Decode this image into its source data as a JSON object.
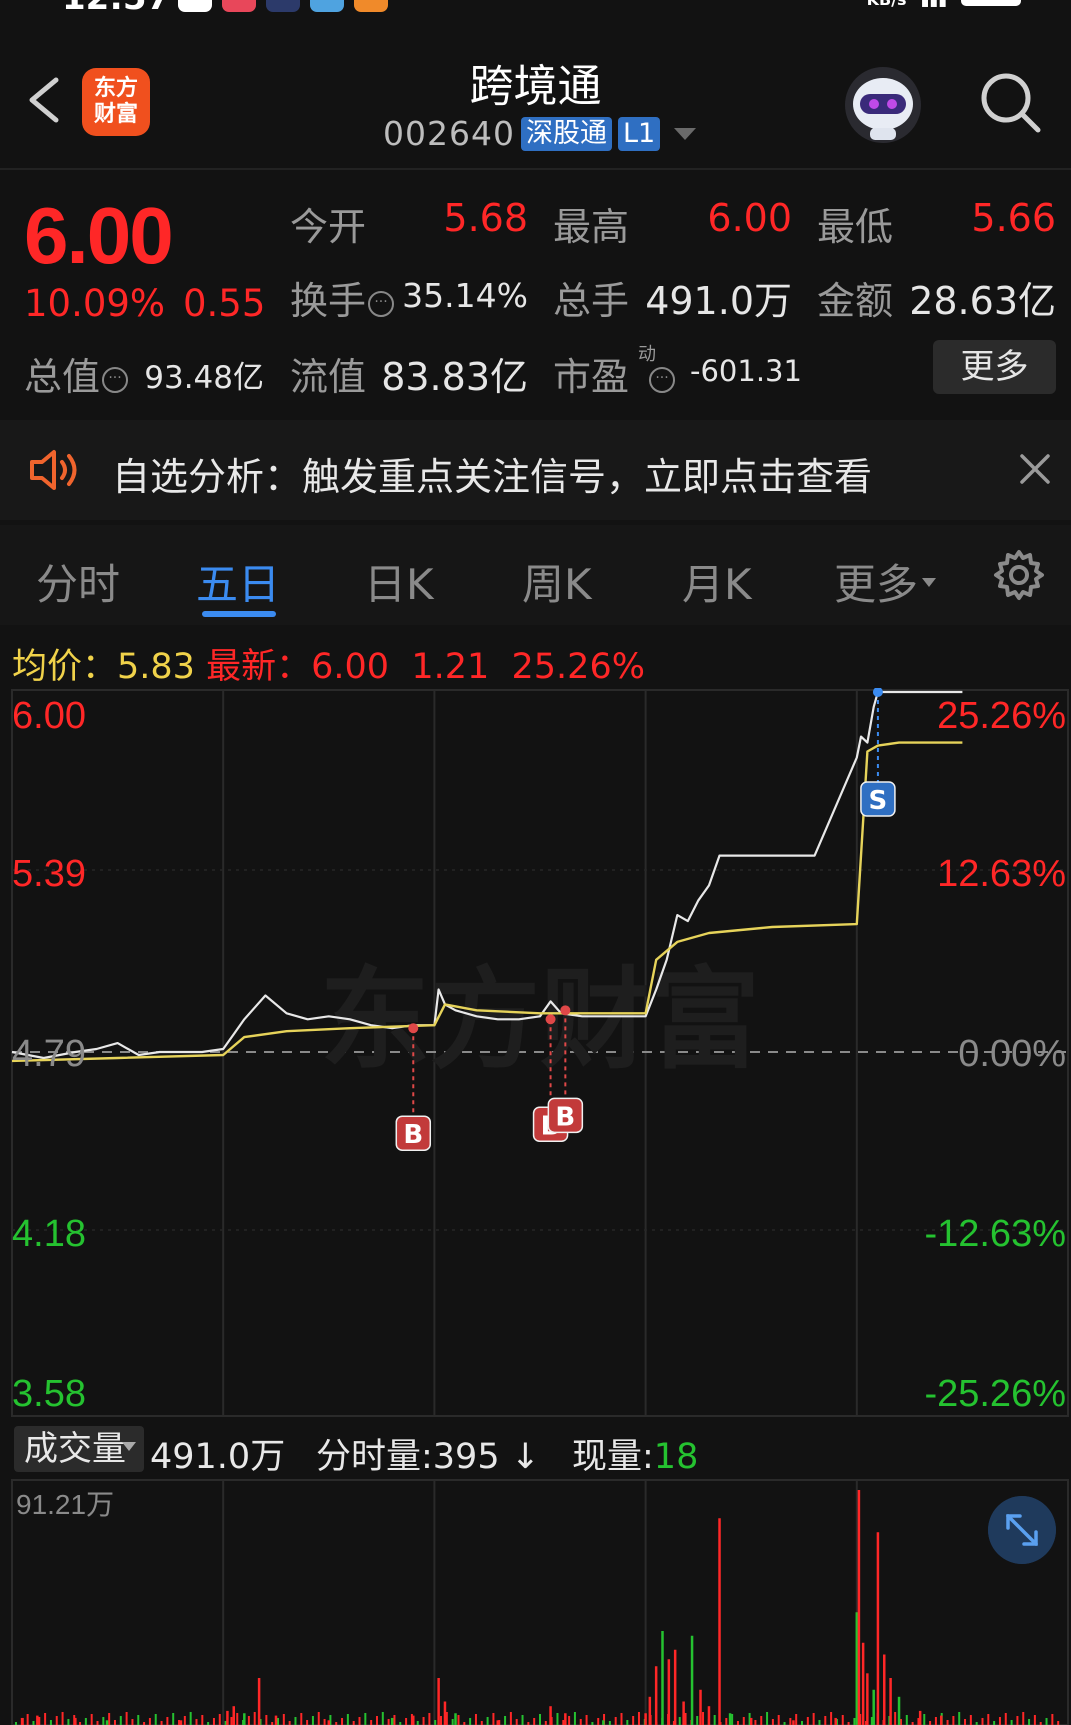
{
  "header": {
    "title": "跨境通",
    "code": "002640",
    "badge1": "深股通",
    "badge2": "L1",
    "logo_line1": "东方",
    "logo_line2": "财富"
  },
  "quote": {
    "price": "6.00",
    "change_pct": "10.09%",
    "change_abs": "0.55",
    "open_label": "今开",
    "open": "5.68",
    "high_label": "最高",
    "high": "6.00",
    "low_label": "最低",
    "low": "5.66",
    "turnover_label": "换手",
    "turnover": "35.14%",
    "volume_label": "总手",
    "volume": "491.0万",
    "amount_label": "金额",
    "amount": "28.63亿",
    "mktcap_label": "总值",
    "mktcap": "93.48亿",
    "float_label": "流值",
    "float_cap": "83.83亿",
    "pe_label": "市盈",
    "pe_sup": "动",
    "pe": "-601.31",
    "more": "更多"
  },
  "notice": {
    "text": "自选分析：触发重点关注信号，立即点击查看"
  },
  "tabs": {
    "items": [
      "分时",
      "五日",
      "日K",
      "周K",
      "月K",
      "更多"
    ],
    "active": "五日"
  },
  "infoline": {
    "avg_label": "均价：",
    "avg": "5.83",
    "latest_label": "最新：",
    "latest": "6.00",
    "chg": "1.21",
    "pct": "25.26%"
  },
  "colors": {
    "up": "#ff2727",
    "down": "#25c230",
    "price_line": "#e8e8e8",
    "avg_line": "#e6d35a",
    "accent": "#3b8bf0"
  },
  "chart_data": {
    "type": "line",
    "title": "",
    "days": 5,
    "y_left_ticks": [
      "6.00",
      "5.39",
      "4.79",
      "4.18",
      "3.58"
    ],
    "y_right_ticks": [
      "25.26%",
      "12.63%",
      "0.00%",
      "-12.63%",
      "-25.26%"
    ],
    "ylim": [
      3.58,
      6.0
    ],
    "base_price": 4.79,
    "series": [
      {
        "x": [
          0,
          0.15,
          0.3,
          0.4,
          0.5,
          0.6,
          0.7,
          0.8,
          0.9,
          1.0,
          1.05,
          1.1,
          1.2,
          1.3,
          1.4,
          1.5,
          1.6,
          1.7,
          1.8,
          1.9,
          2.0,
          2.02,
          2.05,
          2.1,
          2.2,
          2.3,
          2.4,
          2.5,
          2.55,
          2.6,
          2.7,
          2.8,
          2.9,
          3.0,
          3.05,
          3.1,
          3.15,
          3.2,
          3.25,
          3.3,
          3.35,
          3.4,
          3.6,
          3.8,
          4.0,
          4.02,
          4.05,
          4.08,
          4.1,
          4.15,
          4.25,
          4.5
        ],
        "values": [
          4.79,
          4.77,
          4.79,
          4.8,
          4.82,
          4.78,
          4.79,
          4.79,
          4.79,
          4.8,
          4.85,
          4.9,
          4.98,
          4.92,
          4.9,
          4.91,
          4.9,
          4.88,
          4.87,
          4.88,
          4.88,
          5.0,
          4.95,
          4.93,
          4.91,
          4.9,
          4.9,
          4.91,
          4.96,
          4.92,
          4.91,
          4.91,
          4.91,
          4.91,
          5.0,
          5.1,
          5.25,
          5.23,
          5.3,
          5.35,
          5.45,
          5.45,
          5.45,
          5.45,
          5.78,
          5.85,
          5.83,
          5.95,
          6.0,
          6.0,
          6.0,
          6.0
        ]
      },
      {
        "x": [
          0,
          0.5,
          1.0,
          1.1,
          1.3,
          1.6,
          2.0,
          2.05,
          2.2,
          2.5,
          3.0,
          3.05,
          3.15,
          3.3,
          3.6,
          4.0,
          4.05,
          4.1,
          4.2,
          4.5
        ],
        "values": [
          4.76,
          4.77,
          4.78,
          4.84,
          4.86,
          4.87,
          4.88,
          4.95,
          4.93,
          4.92,
          4.92,
          5.1,
          5.16,
          5.19,
          5.21,
          5.22,
          5.8,
          5.82,
          5.83,
          5.83
        ]
      }
    ],
    "markers": [
      {
        "type": "B",
        "x": 1.9,
        "y": 4.87
      },
      {
        "type": "B",
        "x": 2.55,
        "y": 4.9
      },
      {
        "type": "B",
        "x": 2.62,
        "y": 4.93
      },
      {
        "type": "S",
        "x": 4.1,
        "y": 6.0
      }
    ],
    "volume": {
      "label": "成交量",
      "total": "491.0万",
      "tick_label": "分时量:395 ↓",
      "current_label": "现量:",
      "current": "18",
      "max_label": "91.21万",
      "max": 912100,
      "spikes": [
        {
          "x": 0.05,
          "v": 0.03
        },
        {
          "x": 0.12,
          "v": 0.04
        },
        {
          "x": 0.3,
          "v": 0.03
        },
        {
          "x": 0.45,
          "v": 0.02
        },
        {
          "x": 0.8,
          "v": 0.02
        },
        {
          "x": 1.02,
          "v": 0.06
        },
        {
          "x": 1.05,
          "v": 0.08
        },
        {
          "x": 1.1,
          "v": 0.05
        },
        {
          "x": 1.17,
          "v": 0.2
        },
        {
          "x": 1.25,
          "v": 0.04
        },
        {
          "x": 1.5,
          "v": 0.02
        },
        {
          "x": 1.8,
          "v": 0.03
        },
        {
          "x": 1.9,
          "v": 0.04
        },
        {
          "x": 2.02,
          "v": 0.2
        },
        {
          "x": 2.05,
          "v": 0.1
        },
        {
          "x": 2.1,
          "v": 0.05
        },
        {
          "x": 2.3,
          "v": 0.02
        },
        {
          "x": 2.55,
          "v": 0.08
        },
        {
          "x": 2.62,
          "v": 0.05
        },
        {
          "x": 2.8,
          "v": 0.02
        },
        {
          "x": 3.0,
          "v": 0.05
        },
        {
          "x": 3.02,
          "v": 0.12
        },
        {
          "x": 3.05,
          "v": 0.25
        },
        {
          "x": 3.08,
          "v": 0.4
        },
        {
          "x": 3.11,
          "v": 0.28
        },
        {
          "x": 3.14,
          "v": 0.32
        },
        {
          "x": 3.18,
          "v": 0.1
        },
        {
          "x": 3.22,
          "v": 0.38
        },
        {
          "x": 3.26,
          "v": 0.15
        },
        {
          "x": 3.3,
          "v": 0.08
        },
        {
          "x": 3.35,
          "v": 0.88
        },
        {
          "x": 3.4,
          "v": 0.05
        },
        {
          "x": 3.5,
          "v": 0.03
        },
        {
          "x": 3.7,
          "v": 0.02
        },
        {
          "x": 3.9,
          "v": 0.03
        },
        {
          "x": 4.0,
          "v": 0.48
        },
        {
          "x": 4.01,
          "v": 1.0
        },
        {
          "x": 4.03,
          "v": 0.35
        },
        {
          "x": 4.05,
          "v": 0.22
        },
        {
          "x": 4.08,
          "v": 0.15
        },
        {
          "x": 4.1,
          "v": 0.82
        },
        {
          "x": 4.13,
          "v": 0.3
        },
        {
          "x": 4.16,
          "v": 0.2
        },
        {
          "x": 4.2,
          "v": 0.12
        },
        {
          "x": 4.3,
          "v": 0.06
        },
        {
          "x": 4.4,
          "v": 0.04
        }
      ]
    }
  }
}
